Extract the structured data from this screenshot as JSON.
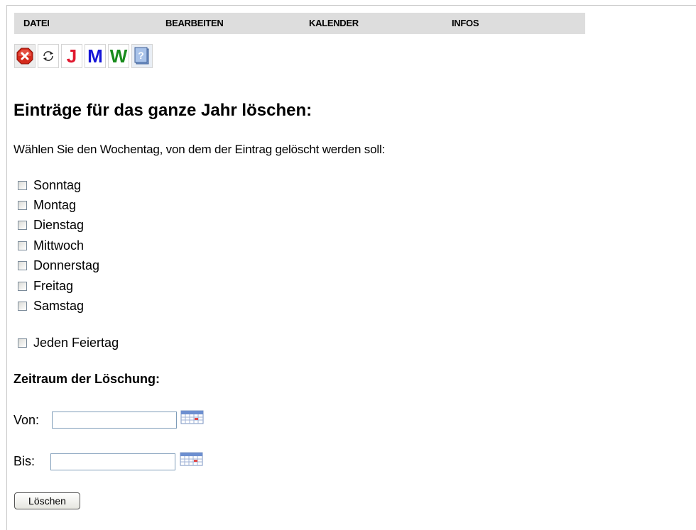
{
  "menu": {
    "items": [
      {
        "label": "DATEI"
      },
      {
        "label": "BEARBEITEN"
      },
      {
        "label": "KALENDER"
      },
      {
        "label": "INFOS"
      }
    ]
  },
  "toolbar": {
    "buttons": [
      {
        "icon": "close-icon"
      },
      {
        "icon": "refresh-icon"
      },
      {
        "letter": "J",
        "color": "#e0182f"
      },
      {
        "letter": "M",
        "color": "#1515d8"
      },
      {
        "letter": "W",
        "color": "#188b1c"
      },
      {
        "icon": "help-icon"
      }
    ]
  },
  "page": {
    "title": "Einträge für das ganze Jahr löschen:",
    "instruction": "Wählen Sie den Wochentag, von dem der Eintrag gelöscht werden soll:"
  },
  "weekdays": [
    {
      "label": "Sonntag",
      "checked": false
    },
    {
      "label": "Montag",
      "checked": false
    },
    {
      "label": "Dienstag",
      "checked": false
    },
    {
      "label": "Mittwoch",
      "checked": false
    },
    {
      "label": "Donnerstag",
      "checked": false
    },
    {
      "label": "Freitag",
      "checked": false
    },
    {
      "label": "Samstag",
      "checked": false
    }
  ],
  "holiday": {
    "label": "Jeden Feiertag",
    "checked": false
  },
  "range": {
    "title": "Zeitraum der Löschung:",
    "from_label": "Von:",
    "from_value": "",
    "to_label": "Bis:",
    "to_value": ""
  },
  "actions": {
    "delete_label": "Löschen"
  }
}
